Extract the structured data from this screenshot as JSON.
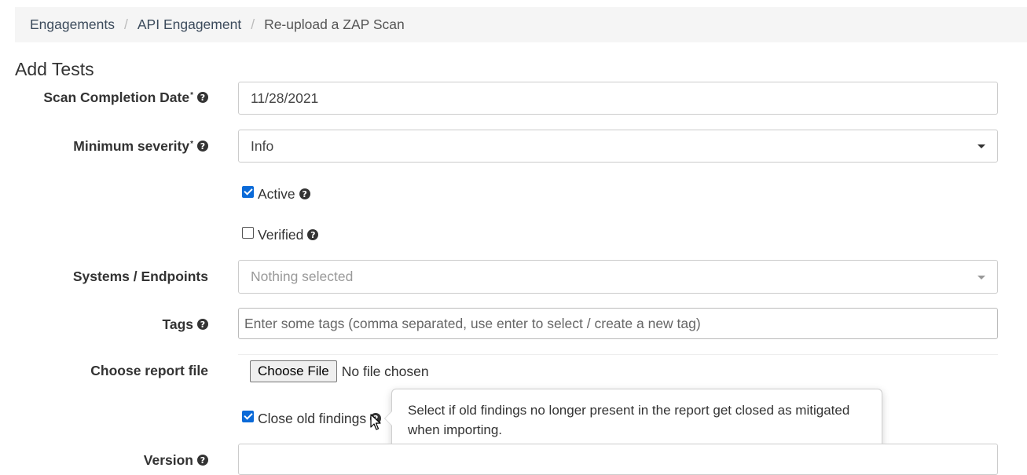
{
  "breadcrumb": {
    "items": [
      "Engagements",
      "API Engagement",
      "Re-upload a ZAP Scan"
    ],
    "separator": "/"
  },
  "page": {
    "title": "Add Tests"
  },
  "form": {
    "scan_date": {
      "label": "Scan Completion Date",
      "required_mark": "*",
      "value": "11/28/2021"
    },
    "min_severity": {
      "label": "Minimum severity",
      "required_mark": "*",
      "value": "Info"
    },
    "active": {
      "label": "Active",
      "checked": true
    },
    "verified": {
      "label": "Verified",
      "checked": false
    },
    "endpoints": {
      "label": "Systems / Endpoints",
      "placeholder": "Nothing selected"
    },
    "tags": {
      "label": "Tags",
      "placeholder": "Enter some tags (comma separated, use enter to select / create a new tag)"
    },
    "report_file": {
      "label": "Choose report file",
      "button_label": "Choose File",
      "status": "No file chosen"
    },
    "close_old": {
      "label": "Close old findings",
      "checked": true
    },
    "version": {
      "label": "Version"
    }
  },
  "tooltip": {
    "text": "Select if old findings no longer present in the report get closed as mitigated when importing."
  },
  "icons": {
    "help": "question-circle-icon",
    "help_glyph": "?"
  },
  "colors": {
    "checkbox_accent": "#0b6ad8",
    "breadcrumb_bg": "#f5f5f5"
  }
}
